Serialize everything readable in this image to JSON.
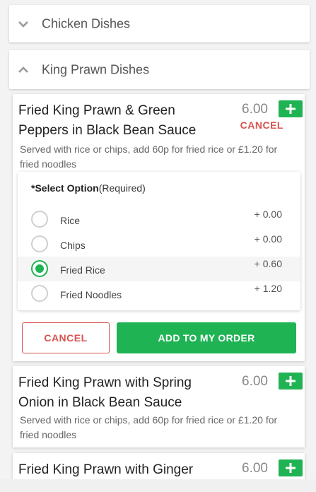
{
  "categories": [
    {
      "title": "Chicken Dishes",
      "expanded": false,
      "icon": "chevron-down-icon"
    },
    {
      "title": "King Prawn Dishes",
      "expanded": true,
      "icon": "chevron-up-icon"
    }
  ],
  "dishes": [
    {
      "name": "Fried King Prawn & Green Peppers in Black Bean Sauce",
      "price": "6.00",
      "cancel_label": "CANCEL",
      "description": "Served with rice or chips, add 60p for fried rice or £1.20 for fried noodles"
    },
    {
      "name": "Fried King Prawn with Spring Onion in Black Bean Sauce",
      "price": "6.00",
      "description": "Served with rice or chips, add 60p for fried rice or £1.20 for fried noodles"
    },
    {
      "name": "Fried King Prawn with Ginger",
      "price": "6.00"
    }
  ],
  "add_icon": "plus-icon",
  "options": {
    "header_bold": "*Select Option",
    "header_note": "(Required)",
    "items": [
      {
        "label": "Rice",
        "price": "+ 0.00",
        "selected": false
      },
      {
        "label": "Chips",
        "price": "+ 0.00",
        "selected": false
      },
      {
        "label": "Fried Rice",
        "price": "+ 0.60",
        "selected": true
      },
      {
        "label": "Fried Noodles",
        "price": "+ 1.20",
        "selected": false
      }
    ]
  },
  "actions": {
    "cancel_label": "CANCEL",
    "add_label": "ADD TO MY ORDER"
  },
  "colors": {
    "accent_green": "#1fb354",
    "cancel_red": "#d9534f"
  }
}
